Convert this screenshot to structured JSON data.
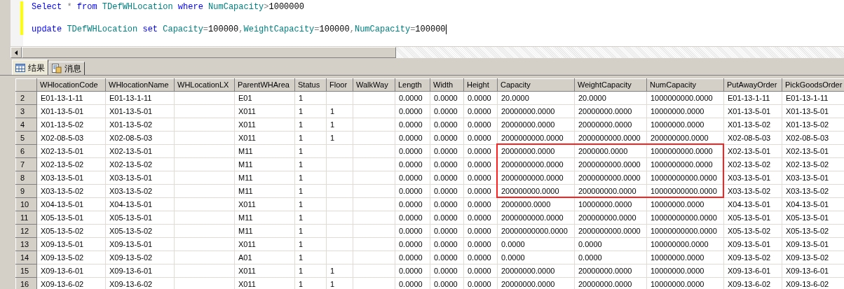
{
  "editor": {
    "lines": [
      {
        "tokens": [
          {
            "text": "Select",
            "kind": "keyword"
          },
          {
            "text": " * ",
            "kind": "operator"
          },
          {
            "text": "from",
            "kind": "keyword"
          },
          {
            "text": " TDefWHLocation ",
            "kind": "identifier"
          },
          {
            "text": "where",
            "kind": "keyword"
          },
          {
            "text": " NumCapacity",
            "kind": "identifier"
          },
          {
            "text": ">",
            "kind": "operator"
          },
          {
            "text": "1000000",
            "kind": "literal"
          }
        ]
      },
      {
        "tokens": [
          {
            "text": "update",
            "kind": "keyword"
          },
          {
            "text": " TDefWHLocation ",
            "kind": "identifier"
          },
          {
            "text": "set",
            "kind": "keyword"
          },
          {
            "text": " Capacity",
            "kind": "identifier"
          },
          {
            "text": "=",
            "kind": "operator"
          },
          {
            "text": "100000",
            "kind": "literal"
          },
          {
            "text": ",",
            "kind": "operator"
          },
          {
            "text": "WeightCapacity",
            "kind": "identifier"
          },
          {
            "text": "=",
            "kind": "operator"
          },
          {
            "text": "100000",
            "kind": "literal"
          },
          {
            "text": ",",
            "kind": "operator"
          },
          {
            "text": "NumCapacity",
            "kind": "identifier"
          },
          {
            "text": "=",
            "kind": "operator"
          },
          {
            "text": "100000",
            "kind": "literal"
          }
        ]
      }
    ]
  },
  "tabs": [
    {
      "label": "结果",
      "kind": "grid",
      "selected": true
    },
    {
      "label": "消息",
      "kind": "messages",
      "selected": false
    }
  ],
  "table": {
    "columns": [
      "WHlocationCode",
      "WHlocationName",
      "WHLocationLX",
      "ParentWHArea",
      "Status",
      "Floor",
      "WalkWay",
      "Length",
      "Width",
      "Height",
      "Capacity",
      "WeightCapacity",
      "NumCapacity",
      "PutAwayOrder",
      "PickGoodsOrder"
    ],
    "rows": [
      {
        "number": "2",
        "cells": [
          "E01-13-1-11",
          "E01-13-1-11",
          "",
          "E01",
          "1",
          "",
          "",
          "0.0000",
          "0.0000",
          "0.0000",
          "20.0000",
          "20.0000",
          "1000000000.0000",
          "E01-13-1-11",
          "E01-13-1-11"
        ]
      },
      {
        "number": "3",
        "cells": [
          "X01-13-5-01",
          "X01-13-5-01",
          "",
          "X011",
          "1",
          "1",
          "",
          "0.0000",
          "0.0000",
          "0.0000",
          "20000000.0000",
          "20000000.0000",
          "10000000.0000",
          "X01-13-5-01",
          "X01-13-5-01"
        ]
      },
      {
        "number": "4",
        "cells": [
          "X01-13-5-02",
          "X01-13-5-02",
          "",
          "X011",
          "1",
          "1",
          "",
          "0.0000",
          "0.0000",
          "0.0000",
          "20000000.0000",
          "20000000.0000",
          "10000000.0000",
          "X01-13-5-02",
          "X01-13-5-02"
        ]
      },
      {
        "number": "5",
        "cells": [
          "X02-08-5-03",
          "X02-08-5-03",
          "",
          "X011",
          "1",
          "1",
          "",
          "0.0000",
          "0.0000",
          "0.0000",
          "2000000000.0000",
          "2000000000.0000",
          "200000000.0000",
          "X02-08-5-03",
          "X02-08-5-03"
        ]
      },
      {
        "number": "6",
        "cells": [
          "X02-13-5-01",
          "X02-13-5-01",
          "",
          "M11",
          "1",
          "",
          "",
          "0.0000",
          "0.0000",
          "0.0000",
          "20000000.0000",
          "2000000.0000",
          "1000000000.0000",
          "X02-13-5-01",
          "X02-13-5-01"
        ]
      },
      {
        "number": "7",
        "cells": [
          "X02-13-5-02",
          "X02-13-5-02",
          "",
          "M11",
          "1",
          "",
          "",
          "0.0000",
          "0.0000",
          "0.0000",
          "2000000000.0000",
          "2000000000.0000",
          "1000000000.0000",
          "X02-13-5-02",
          "X02-13-5-02"
        ]
      },
      {
        "number": "8",
        "cells": [
          "X03-13-5-01",
          "X03-13-5-01",
          "",
          "M11",
          "1",
          "",
          "",
          "0.0000",
          "0.0000",
          "0.0000",
          "2000000000.0000",
          "2000000000.0000",
          "10000000000.0000",
          "X03-13-5-01",
          "X03-13-5-01"
        ]
      },
      {
        "number": "9",
        "cells": [
          "X03-13-5-02",
          "X03-13-5-02",
          "",
          "M11",
          "1",
          "",
          "",
          "0.0000",
          "0.0000",
          "0.0000",
          "200000000.0000",
          "200000000.0000",
          "10000000000.0000",
          "X03-13-5-02",
          "X03-13-5-02"
        ]
      },
      {
        "number": "10",
        "cells": [
          "X04-13-5-01",
          "X04-13-5-01",
          "",
          "X011",
          "1",
          "",
          "",
          "0.0000",
          "0.0000",
          "0.0000",
          "2000000.0000",
          "10000000.0000",
          "10000000.0000",
          "X04-13-5-01",
          "X04-13-5-01"
        ]
      },
      {
        "number": "11",
        "cells": [
          "X05-13-5-01",
          "X05-13-5-01",
          "",
          "M11",
          "1",
          "",
          "",
          "0.0000",
          "0.0000",
          "0.0000",
          "2000000000.0000",
          "200000000.0000",
          "10000000000.0000",
          "X05-13-5-01",
          "X05-13-5-01"
        ]
      },
      {
        "number": "12",
        "cells": [
          "X05-13-5-02",
          "X05-13-5-02",
          "",
          "M11",
          "1",
          "",
          "",
          "0.0000",
          "0.0000",
          "0.0000",
          "20000000000.0000",
          "2000000000.0000",
          "10000000000.0000",
          "X05-13-5-02",
          "X05-13-5-02"
        ]
      },
      {
        "number": "13",
        "cells": [
          "X09-13-5-01",
          "X09-13-5-01",
          "",
          "X011",
          "1",
          "",
          "",
          "0.0000",
          "0.0000",
          "0.0000",
          "0.0000",
          "0.0000",
          "100000000.0000",
          "X09-13-5-01",
          "X09-13-5-01"
        ]
      },
      {
        "number": "14",
        "cells": [
          "X09-13-5-02",
          "X09-13-5-02",
          "",
          "A01",
          "1",
          "",
          "",
          "0.0000",
          "0.0000",
          "0.0000",
          "0.0000",
          "0.0000",
          "10000000.0000",
          "X09-13-5-02",
          "X09-13-5-02"
        ]
      },
      {
        "number": "15",
        "cells": [
          "X09-13-6-01",
          "X09-13-6-01",
          "",
          "X011",
          "1",
          "1",
          "",
          "0.0000",
          "0.0000",
          "0.0000",
          "20000000.0000",
          "20000000.0000",
          "10000000.0000",
          "X09-13-6-01",
          "X09-13-6-01"
        ]
      },
      {
        "number": "16",
        "cells": [
          "X09-13-6-02",
          "X09-13-6-02",
          "",
          "X011",
          "1",
          "1",
          "",
          "0.0000",
          "0.0000",
          "0.0000",
          "20000000.0000",
          "20000000.0000",
          "10000000.0000",
          "X09-13-6-02",
          "X09-13-6-02"
        ]
      }
    ]
  }
}
